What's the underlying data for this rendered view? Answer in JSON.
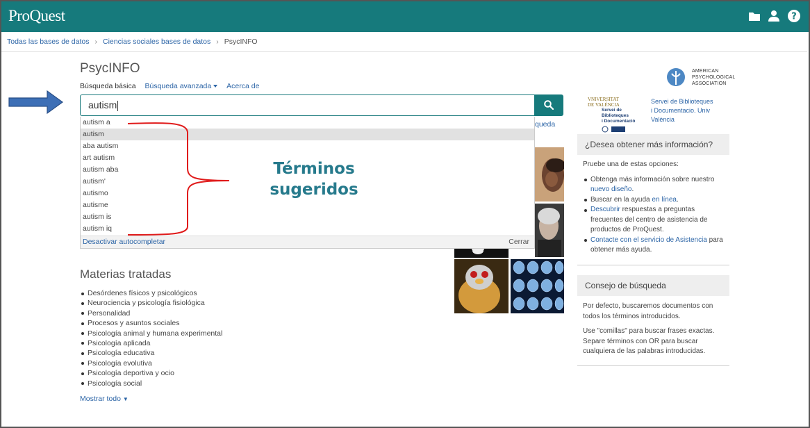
{
  "app": {
    "logo": "ProQuest"
  },
  "header_icons": [
    "folder-icon",
    "user-icon",
    "help-icon"
  ],
  "colors": {
    "brand": "#167a7c",
    "link": "#2b64a6",
    "annotation": "#267a8c",
    "brace": "#e01b1b",
    "arrow": "#3d6fb6"
  },
  "breadcrumb": {
    "item1": "Todas las bases de datos",
    "item2": "Ciencias sociales bases de datos",
    "item3": "PsycINFO"
  },
  "database": {
    "title": "PsycINFO"
  },
  "tabs": {
    "basic": "Búsqueda básica",
    "advanced": "Búsqueda avanzada",
    "about": "Acerca de"
  },
  "search": {
    "value": "autism"
  },
  "hidden_link": "queda",
  "suggestions": [
    "autism a",
    "autism",
    "aba autism",
    "art autism",
    "autism aba",
    "autism'",
    "autismo",
    "autisme",
    "autism is",
    "autism iq"
  ],
  "dropdown": {
    "disable": "Desactivar autocompletar",
    "close": "Cerrar"
  },
  "annotation": {
    "line1": "Términos",
    "line2": "sugeridos"
  },
  "subjects": {
    "title": "Materias tratadas",
    "items": [
      "Desórdenes físicos y psicológicos",
      "Neurociencia y psicología fisiológica",
      "Personalidad",
      "Procesos y asuntos sociales",
      "Psicología animal y humana experimental",
      "Psicología aplicada",
      "Psicología educativa",
      "Psicología evolutiva",
      "Psicología deportiva y ocio",
      "Psicología social"
    ],
    "show_all": "Mostrar todo"
  },
  "apa": {
    "line1": "American",
    "line2": "Psychological",
    "line3": "Association"
  },
  "uv": {
    "line1": "Vniversitat",
    "line2": "de València",
    "line3": "Servei de Biblioteques",
    "line4": "i Documentació",
    "link_line1": "Servei de Biblioteques",
    "link_line2": "i Documentacio. Univ",
    "link_line3": "València"
  },
  "info_panel": {
    "title": "¿Desea obtener más información?",
    "intro": "Pruebe una de estas opciones:",
    "i1_text": "Obtenga más información sobre nuestro ",
    "i1_link": "nuevo diseño",
    "i1_end": ".",
    "i2_text": "Buscar en la ayuda ",
    "i2_link": "en línea",
    "i2_end": ".",
    "i3_link": "Descubrir",
    "i3_text": " respuestas a preguntas frecuentes del centro de asistencia de productos de ProQuest.",
    "i4_link": "Contacte con el servicio de Asistencia",
    "i4_text": " para obtener más ayuda."
  },
  "tip_panel": {
    "title": "Consejo de búsqueda",
    "p1": "Por defecto, buscaremos documentos con todos los términos introducidos.",
    "p2": "Use \"comillas\" para buscar frases exactas. Separe términos con OR para buscar cualquiera de las palabras introducidas."
  }
}
